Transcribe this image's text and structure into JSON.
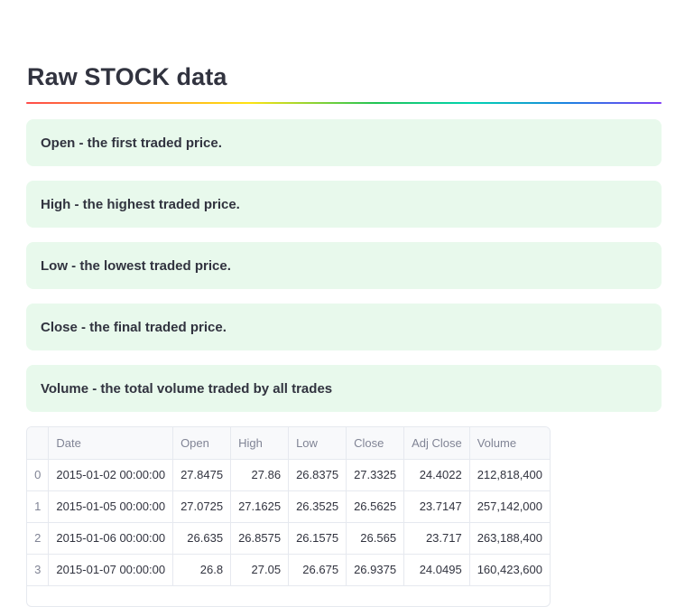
{
  "page": {
    "title": "Raw STOCK data"
  },
  "callouts": [
    "Open - the first traded price.",
    "High - the highest traded price.",
    "Low - the lowest traded price.",
    "Close - the final traded price.",
    "Volume - the total volume traded by all trades"
  ],
  "table": {
    "columns": [
      "",
      "Date",
      "Open",
      "High",
      "Low",
      "Close",
      "Adj Close",
      "Volume"
    ],
    "rows": [
      [
        "0",
        "2015-01-02 00:00:00",
        "27.8475",
        "27.86",
        "26.8375",
        "27.3325",
        "24.4022",
        "212,818,400"
      ],
      [
        "1",
        "2015-01-05 00:00:00",
        "27.0725",
        "27.1625",
        "26.3525",
        "26.5625",
        "23.7147",
        "257,142,000"
      ],
      [
        "2",
        "2015-01-06 00:00:00",
        "26.635",
        "26.8575",
        "26.1575",
        "26.565",
        "23.717",
        "263,188,400"
      ],
      [
        "3",
        "2015-01-07 00:00:00",
        "26.8",
        "27.05",
        "26.675",
        "26.9375",
        "24.0495",
        "160,423,600"
      ]
    ]
  },
  "colors": {
    "callout_bg": "#e8f9ec",
    "text": "#31333f",
    "header_text": "#808495"
  }
}
